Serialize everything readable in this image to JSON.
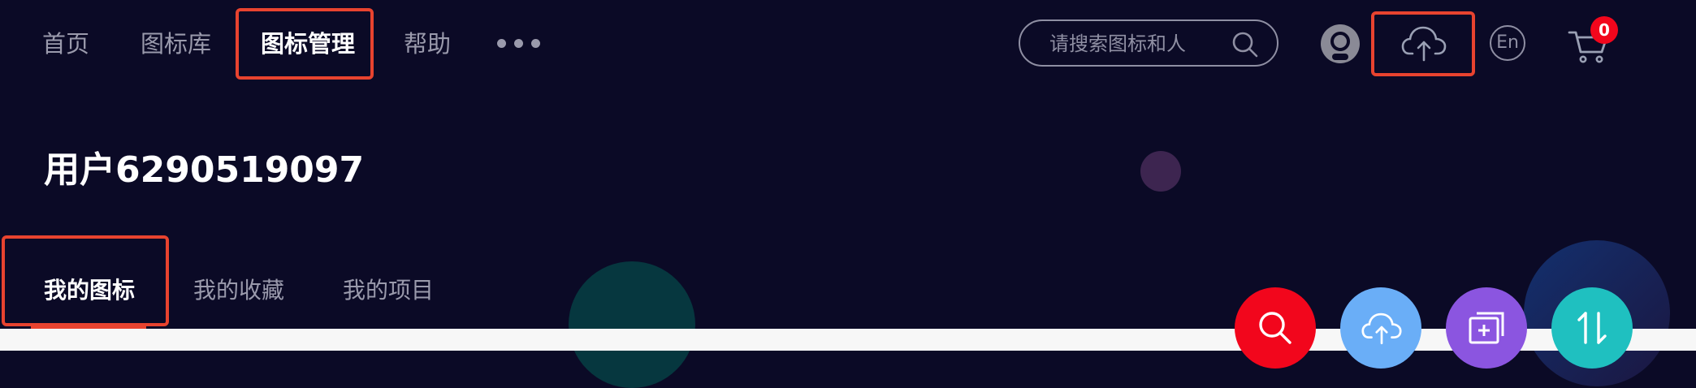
{
  "nav": {
    "items": [
      {
        "label": "首页"
      },
      {
        "label": "图标库"
      },
      {
        "label": "图标管理"
      },
      {
        "label": "帮助"
      }
    ],
    "more_icon": "more-dots-icon"
  },
  "search": {
    "placeholder": "请搜索图标和人",
    "icon": "search-icon"
  },
  "header_actions": {
    "avatar_icon": "github-avatar-icon",
    "upload_icon": "cloud-upload-icon",
    "lang_label": "En",
    "cart_icon": "cart-icon",
    "cart_count": "0"
  },
  "profile": {
    "username": "用户6290519097"
  },
  "tabs": [
    {
      "label": "我的图标"
    },
    {
      "label": "我的收藏"
    },
    {
      "label": "我的项目"
    }
  ],
  "fab_buttons": [
    {
      "icon": "search-icon",
      "color": "#f2061c"
    },
    {
      "icon": "cloud-upload-icon",
      "color": "#6aaef7"
    },
    {
      "icon": "add-to-folder-icon",
      "color": "#8b55e0"
    },
    {
      "icon": "sort-icon",
      "color": "#1fc0c0"
    }
  ],
  "colors": {
    "background": "#0b0a26",
    "accent": "#e8432f",
    "badge": "#f2061c"
  }
}
